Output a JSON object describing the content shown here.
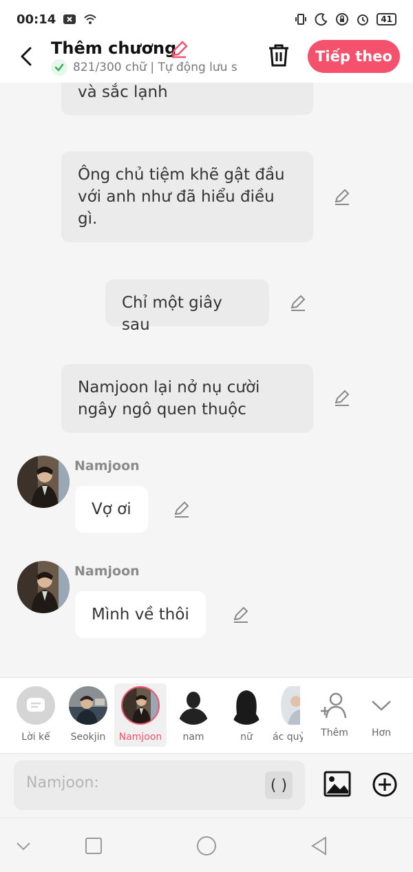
{
  "status_bar": {
    "time": "00:14",
    "battery": "41"
  },
  "header": {
    "title": "Thêm chương",
    "subtitle": "821/300 chữ | Tự động lưu s",
    "next_label": "Tiếp theo"
  },
  "messages": [
    {
      "type": "narration",
      "text": "và sắc lạnh"
    },
    {
      "type": "narration",
      "text": "Ông chủ tiệm khẽ gật đầu với anh như đã hiểu điều gì."
    },
    {
      "type": "narration",
      "text": "Chỉ một giây sau"
    },
    {
      "type": "narration",
      "text": "Namjoon lại nở nụ cười ngây ngô quen thuộc"
    },
    {
      "type": "character",
      "sender": "Namjoon",
      "text": "Vợ ơi"
    },
    {
      "type": "character",
      "sender": "Namjoon",
      "text": "Mình về thôi"
    }
  ],
  "characters": [
    {
      "name": "Lời kể"
    },
    {
      "name": "Seokjin"
    },
    {
      "name": "Namjoon",
      "selected": true
    },
    {
      "name": "nam"
    },
    {
      "name": "nữ"
    },
    {
      "name": "ác quỷ"
    },
    {
      "name": "Thêm"
    },
    {
      "name": "Hơn"
    }
  ],
  "input": {
    "placeholder": "Namjoon:",
    "paren_label": "( )"
  },
  "colors": {
    "accent": "#f4516c",
    "bubble": "#ebebeb",
    "background": "#f5f5f5"
  }
}
